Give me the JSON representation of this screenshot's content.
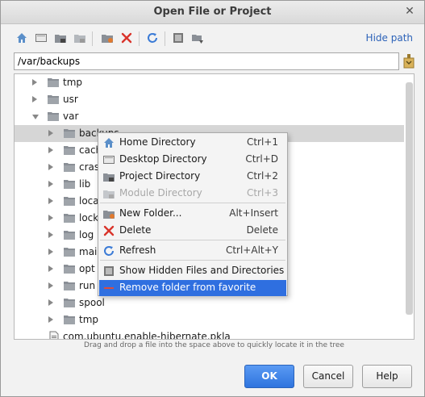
{
  "window": {
    "title": "Open File or Project"
  },
  "toolbar": {
    "buttons": [
      {
        "icon": "home-icon"
      },
      {
        "icon": "desktop-icon"
      },
      {
        "icon": "project-icon"
      },
      {
        "icon": "module-icon"
      },
      {
        "icon": "new-folder-icon"
      },
      {
        "icon": "delete-icon"
      },
      {
        "icon": "refresh-icon"
      },
      {
        "icon": "show-hidden-icon"
      },
      {
        "icon": "favorite-folder-icon"
      }
    ],
    "hide_path_label": "Hide path"
  },
  "path": {
    "value": "/var/backups"
  },
  "tree": {
    "rows": [
      {
        "label": "tmp",
        "expanded": false,
        "depth": 0
      },
      {
        "label": "usr",
        "expanded": false,
        "depth": 0
      },
      {
        "label": "var",
        "expanded": true,
        "depth": 0
      },
      {
        "label": "backups",
        "expanded": false,
        "depth": 1,
        "selected": true
      },
      {
        "label": "cach",
        "expanded": false,
        "depth": 1
      },
      {
        "label": "cras",
        "expanded": false,
        "depth": 1
      },
      {
        "label": "lib",
        "expanded": false,
        "depth": 1
      },
      {
        "label": "local",
        "expanded": false,
        "depth": 1
      },
      {
        "label": "lock",
        "expanded": false,
        "depth": 1
      },
      {
        "label": "log",
        "expanded": false,
        "depth": 1
      },
      {
        "label": "mail",
        "expanded": false,
        "depth": 1
      },
      {
        "label": "opt",
        "expanded": false,
        "depth": 1
      },
      {
        "label": "run",
        "expanded": false,
        "depth": 1
      },
      {
        "label": "spool",
        "expanded": false,
        "depth": 1
      },
      {
        "label": "tmp",
        "expanded": false,
        "depth": 1
      },
      {
        "label": "com.ubuntu.enable-hibernate.pkla",
        "file": true,
        "depth": 0
      }
    ]
  },
  "hint": "Drag and drop a file into the space above to quickly locate it in the tree",
  "buttons": {
    "ok": "OK",
    "cancel": "Cancel",
    "help": "Help"
  },
  "context_menu": {
    "items": [
      {
        "label": "Home Directory",
        "shortcut": "Ctrl+1",
        "icon": "home-icon"
      },
      {
        "label": "Desktop Directory",
        "shortcut": "Ctrl+D",
        "icon": "desktop-icon"
      },
      {
        "label": "Project Directory",
        "shortcut": "Ctrl+2",
        "icon": "project-icon"
      },
      {
        "label": "Module Directory",
        "shortcut": "Ctrl+3",
        "icon": "module-icon",
        "disabled": true
      },
      {
        "label": "New Folder...",
        "shortcut": "Alt+Insert",
        "icon": "new-folder-icon"
      },
      {
        "label": "Delete",
        "shortcut": "Delete",
        "icon": "delete-icon"
      },
      {
        "label": "Refresh",
        "shortcut": "Ctrl+Alt+Y",
        "icon": "refresh-icon"
      },
      {
        "label": "Show Hidden Files and Directories",
        "shortcut": "",
        "icon": "show-hidden-icon"
      },
      {
        "label": "Remove folder from favorite",
        "shortcut": "",
        "icon": "remove-favorite-icon",
        "active": true
      }
    ]
  },
  "colors": {
    "accent": "#2f6fe0",
    "link": "#2c62b8",
    "delete": "#d9342b",
    "refresh": "#3b7bd6",
    "folder": "#8a8f96"
  }
}
